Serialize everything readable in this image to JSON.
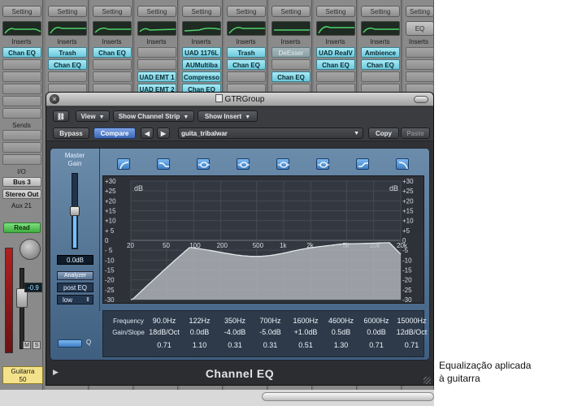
{
  "mixer": {
    "setting_label": "Setting",
    "eq_label": "EQ",
    "inserts_label": "Inserts",
    "strips": [
      {
        "inserts": [
          "Chan EQ"
        ]
      },
      {
        "inserts": [
          "Trash",
          "Chan EQ"
        ]
      },
      {
        "inserts": [
          "Chan EQ"
        ]
      },
      {
        "inserts": [
          "",
          "",
          "UAD EMT 1",
          "UAD EMT 2",
          "Chan EQ"
        ]
      },
      {
        "inserts": [
          "UAD 1176L",
          "AUMultiba",
          "Compresso",
          "Chan EQ"
        ]
      },
      {
        "inserts": [
          "Trash",
          "Chan EQ"
        ]
      },
      {
        "inserts": [
          "DeEsser",
          "",
          "Chan EQ"
        ]
      },
      {
        "inserts": [
          "UAD RealV",
          "Chan EQ"
        ]
      },
      {
        "inserts": [
          "Ambience",
          "Chan EQ"
        ]
      }
    ],
    "left_strip": {
      "sends_label": "Sends",
      "io_label": "I/O",
      "input": "Bus 3",
      "output": "Stereo Out",
      "aux": "Aux 21",
      "automation": "Read",
      "volume": "-0.9",
      "mute_label": "M",
      "solo_label": "S",
      "track_name": "Guitarra",
      "track_number": "50"
    }
  },
  "plugin_window": {
    "title": "GTRGroup",
    "toolbar": {
      "view_label": "View",
      "show_channel_strip_label": "Show Channel Strip",
      "show_insert_label": "Show Insert",
      "bypass_label": "Bypass",
      "compare_label": "Compare",
      "prev_label": "◀",
      "next_label": "▶",
      "preset_name": "guita_tribalwar",
      "copy_label": "Copy",
      "paste_label": "Paste"
    },
    "eq": {
      "master_gain_label": "Master\nGain",
      "master_gain_value": "0.0dB",
      "analyzer_label": "Analyzer",
      "analyzer_mode": "post EQ",
      "analyzer_resolution": "low",
      "db_unit": "dB",
      "db_ticks_left": [
        "+30",
        "+25",
        "+20",
        "+15",
        "+10",
        "+ 5",
        "0",
        "- 5",
        "-10",
        "-15",
        "-20",
        "-25",
        "-30"
      ],
      "db_ticks_right": [
        "+30",
        "+25",
        "+20",
        "+15",
        "+10",
        "+5",
        "0",
        "-5",
        "-10",
        "-15",
        "-20",
        "-25",
        "-30"
      ],
      "freq_ticks": [
        "20",
        "50",
        "100",
        "200",
        "500",
        "1k",
        "2k",
        "5k",
        "10k",
        "20k"
      ],
      "frequency_label": "Frequency",
      "gain_slope_label": "Gain/Slope",
      "q_label": "Q",
      "bands": [
        {
          "frequency": "90.0Hz",
          "gain": "18dB/Oct",
          "q": "0.71"
        },
        {
          "frequency": "122Hz",
          "gain": "0.0dB",
          "q": "1.10"
        },
        {
          "frequency": "350Hz",
          "gain": "-4.0dB",
          "q": "0.31"
        },
        {
          "frequency": "700Hz",
          "gain": "-5.0dB",
          "q": "0.31"
        },
        {
          "frequency": "1600Hz",
          "gain": "+1.0dB",
          "q": "0.51"
        },
        {
          "frequency": "4600Hz",
          "gain": "0.5dB",
          "q": "1.30"
        },
        {
          "frequency": "6000Hz",
          "gain": "0.0dB",
          "q": "0.71"
        },
        {
          "frequency": "15000Hz",
          "gain": "12dB/Oct",
          "q": "0.71"
        }
      ],
      "curve_color": "#b8bcc2",
      "accent_color": "#5d9be0"
    },
    "footer_title": "Channel EQ"
  },
  "caption": {
    "line1": "Equalização aplicada",
    "line2": "à guitarra"
  }
}
